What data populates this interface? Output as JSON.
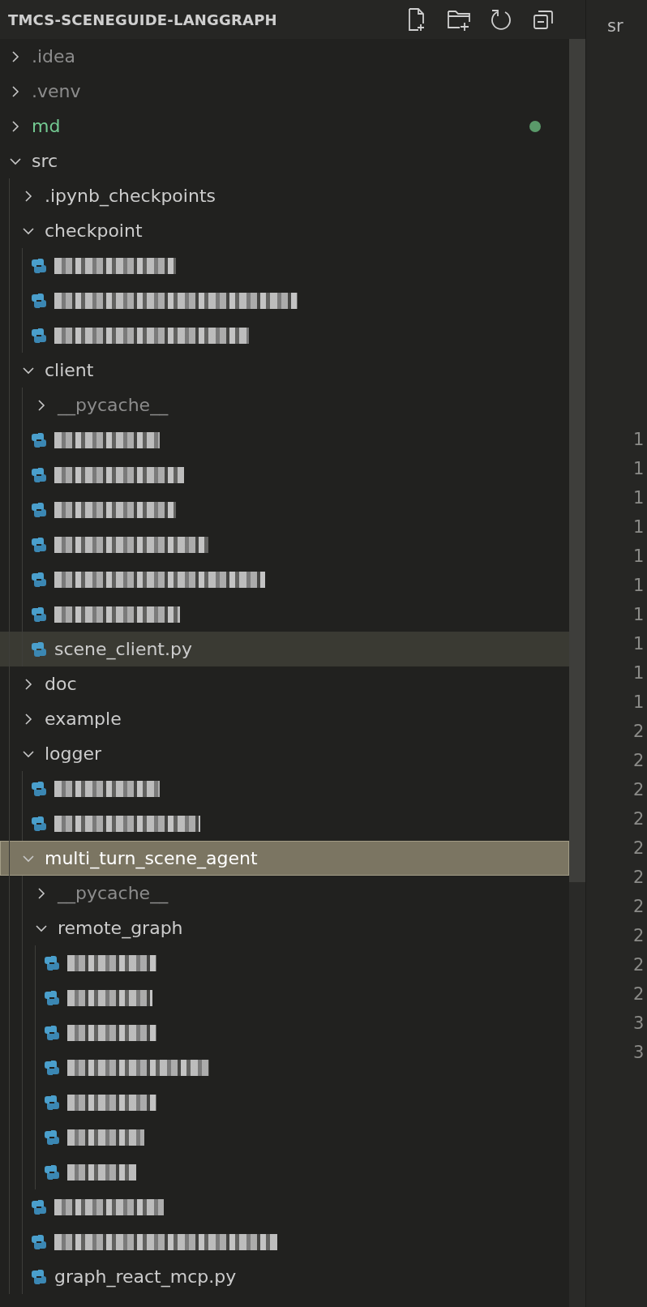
{
  "explorer": {
    "title": "TMCS-SCENEGUIDE-LANGGRAPH",
    "tree": [
      {
        "kind": "folder",
        "name": ".idea",
        "expanded": false,
        "selected": false,
        "hovered": false,
        "ignored": true,
        "untracked": false
      },
      {
        "kind": "folder",
        "name": ".venv",
        "expanded": false,
        "selected": false,
        "hovered": false,
        "ignored": true,
        "untracked": false
      },
      {
        "kind": "folder",
        "name": "md",
        "expanded": false,
        "selected": false,
        "hovered": false,
        "ignored": false,
        "untracked": true
      },
      {
        "kind": "folder",
        "name": "src",
        "expanded": true,
        "selected": false,
        "hovered": false,
        "ignored": false,
        "untracked": false,
        "children": [
          {
            "kind": "folder",
            "name": ".ipynb_checkpoints",
            "expanded": false,
            "selected": false,
            "hovered": false,
            "ignored": false,
            "untracked": false
          },
          {
            "kind": "folder",
            "name": "checkpoint",
            "expanded": true,
            "selected": false,
            "hovered": false,
            "ignored": false,
            "untracked": false,
            "children": [
              {
                "kind": "redacted",
                "selected": false,
                "hovered": false
              },
              {
                "kind": "redacted",
                "selected": false,
                "hovered": false
              },
              {
                "kind": "redacted",
                "selected": false,
                "hovered": false
              }
            ]
          },
          {
            "kind": "folder",
            "name": "client",
            "expanded": true,
            "selected": false,
            "hovered": false,
            "ignored": false,
            "untracked": false,
            "children": [
              {
                "kind": "folder",
                "name": "__pycache__",
                "expanded": false,
                "selected": false,
                "hovered": false,
                "ignored": true,
                "untracked": false
              },
              {
                "kind": "redacted",
                "selected": false,
                "hovered": false
              },
              {
                "kind": "redacted",
                "selected": false,
                "hovered": false
              },
              {
                "kind": "redacted",
                "selected": false,
                "hovered": false
              },
              {
                "kind": "redacted",
                "selected": false,
                "hovered": false
              },
              {
                "kind": "redacted",
                "selected": false,
                "hovered": false
              },
              {
                "kind": "redacted",
                "selected": false,
                "hovered": false
              },
              {
                "kind": "python",
                "name": "scene_client.py",
                "selected": false,
                "hovered": true,
                "ignored": false,
                "untracked": false
              }
            ]
          },
          {
            "kind": "folder",
            "name": "doc",
            "expanded": false,
            "selected": false,
            "hovered": false,
            "ignored": false,
            "untracked": false
          },
          {
            "kind": "folder",
            "name": "example",
            "expanded": false,
            "selected": false,
            "hovered": false,
            "ignored": false,
            "untracked": false
          },
          {
            "kind": "folder",
            "name": "logger",
            "expanded": true,
            "selected": false,
            "hovered": false,
            "ignored": false,
            "untracked": false,
            "children": [
              {
                "kind": "redacted",
                "selected": false,
                "hovered": false
              },
              {
                "kind": "redacted",
                "selected": false,
                "hovered": false
              }
            ]
          },
          {
            "kind": "folder",
            "name": "multi_turn_scene_agent",
            "expanded": true,
            "selected": true,
            "hovered": false,
            "ignored": false,
            "untracked": false,
            "children": [
              {
                "kind": "folder",
                "name": "__pycache__",
                "expanded": false,
                "selected": false,
                "hovered": false,
                "ignored": true,
                "untracked": false
              },
              {
                "kind": "folder",
                "name": "remote_graph",
                "expanded": true,
                "selected": false,
                "hovered": false,
                "ignored": false,
                "untracked": false,
                "children": [
                  {
                    "kind": "redacted",
                    "selected": false,
                    "hovered": false
                  },
                  {
                    "kind": "redacted",
                    "selected": false,
                    "hovered": false
                  },
                  {
                    "kind": "redacted",
                    "selected": false,
                    "hovered": false
                  },
                  {
                    "kind": "redacted",
                    "selected": false,
                    "hovered": false
                  },
                  {
                    "kind": "redacted",
                    "selected": false,
                    "hovered": false
                  },
                  {
                    "kind": "redacted",
                    "selected": false,
                    "hovered": false
                  },
                  {
                    "kind": "redacted",
                    "selected": false,
                    "hovered": false
                  }
                ]
              },
              {
                "kind": "redacted",
                "selected": false,
                "hovered": false
              },
              {
                "kind": "redacted",
                "selected": false,
                "hovered": false
              },
              {
                "kind": "python",
                "name": "graph_react_mcp.py",
                "selected": false,
                "hovered": false,
                "ignored": false,
                "untracked": false
              }
            ]
          }
        ]
      }
    ]
  },
  "editor": {
    "tab_label": "sr",
    "line_numbers": [
      "1",
      "1",
      "1",
      "1",
      "1",
      "1",
      "1",
      "1",
      "1",
      "1",
      "2",
      "2",
      "2",
      "2",
      "2",
      "2",
      "2",
      "2",
      "2",
      "2",
      "3",
      "3"
    ]
  }
}
